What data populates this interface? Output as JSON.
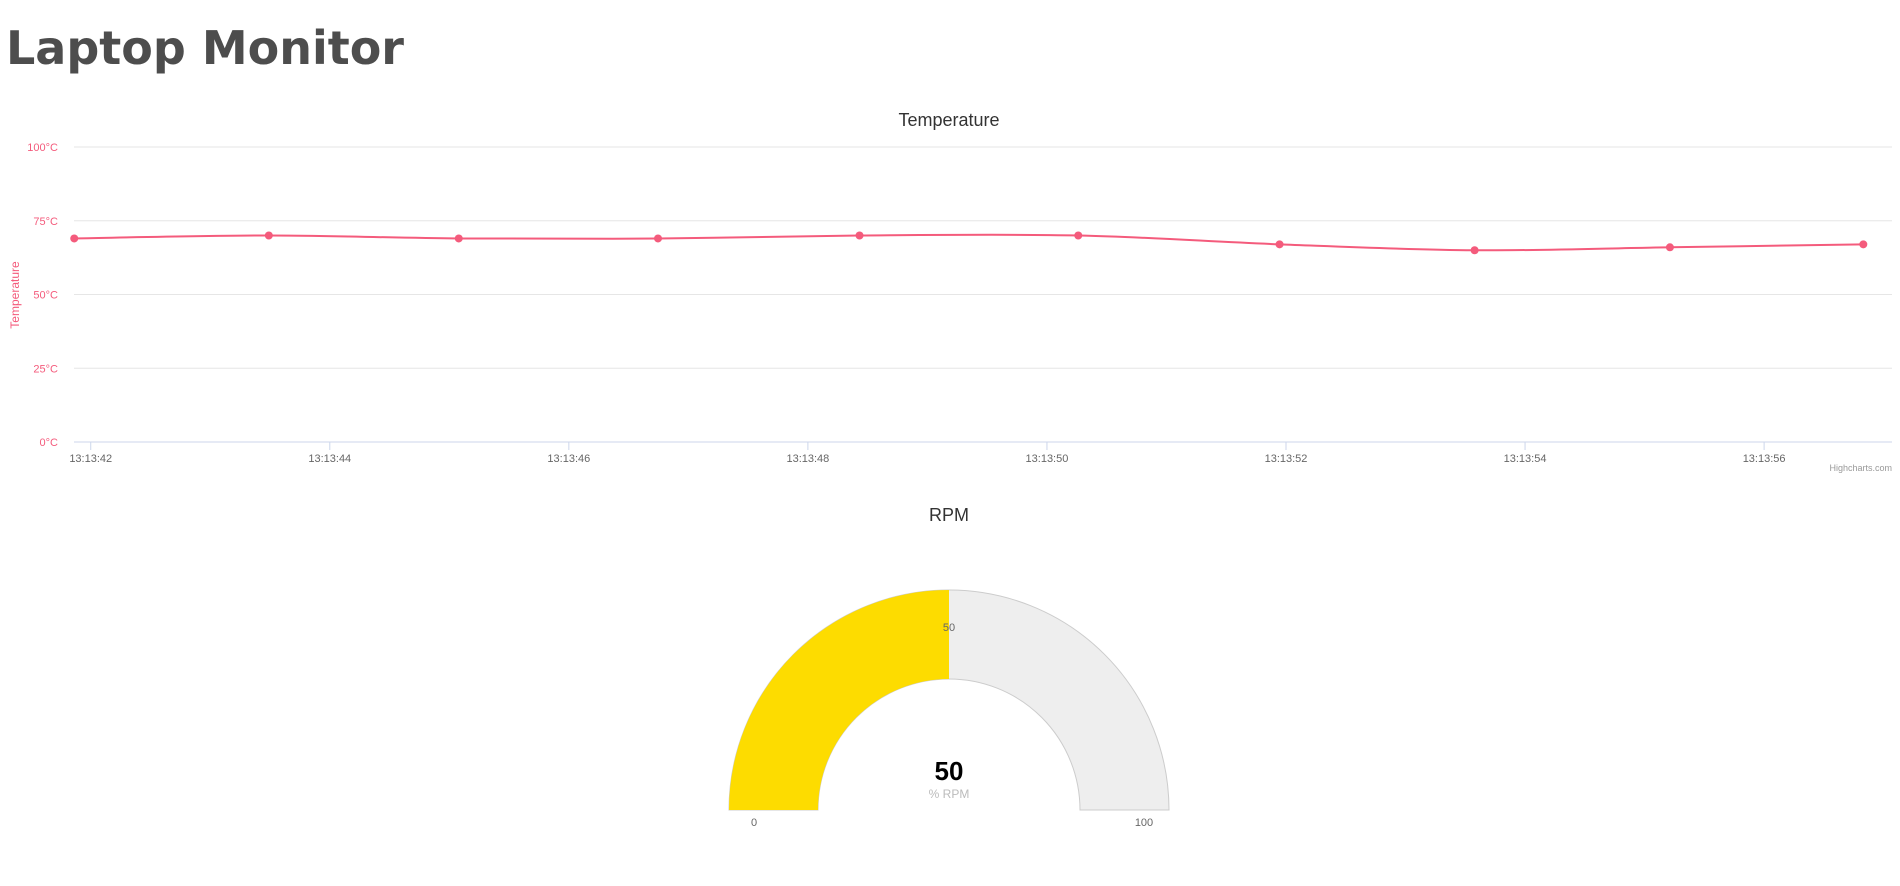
{
  "page": {
    "title": "Laptop Monitor"
  },
  "chart_data": [
    {
      "type": "line",
      "title": "Temperature",
      "ylabel": "Temperature",
      "xlabel": "",
      "ylim": [
        0,
        100
      ],
      "y_ticks": [
        "0°C",
        "25°C",
        "50°C",
        "75°C",
        "100°C"
      ],
      "x_ticks": [
        "13:13:42",
        "13:13:44",
        "13:13:46",
        "13:13:48",
        "13:13:50",
        "13:13:52",
        "13:13:54",
        "13:13:56"
      ],
      "x_tick_seconds": [
        42,
        44,
        46,
        48,
        50,
        52,
        54,
        56
      ],
      "x_range_seconds": [
        41.86,
        57.07
      ],
      "series": [
        {
          "color": "#f45b7c",
          "x": [
            "13:13:41.862",
            "13:13:43.490",
            "13:13:45.079",
            "13:13:46.746",
            "13:13:48.432",
            "13:13:50.262",
            "13:13:51.946",
            "13:13:53.578",
            "13:13:55.212",
            "13:13:56.830"
          ],
          "values": [
            69,
            70,
            69,
            69,
            70,
            70,
            67,
            65,
            66,
            67
          ]
        }
      ],
      "grid": true,
      "legend": "none",
      "credits": "Highcharts.com"
    },
    {
      "type": "gauge",
      "title": "RPM",
      "value": 50,
      "min": 0,
      "max": 100,
      "value_label": "50",
      "unit_label": "% RPM",
      "min_label": "0",
      "max_label": "100",
      "mid_label": "50",
      "fill_color": "#fddc00",
      "track_color": "#eeeeee"
    }
  ]
}
